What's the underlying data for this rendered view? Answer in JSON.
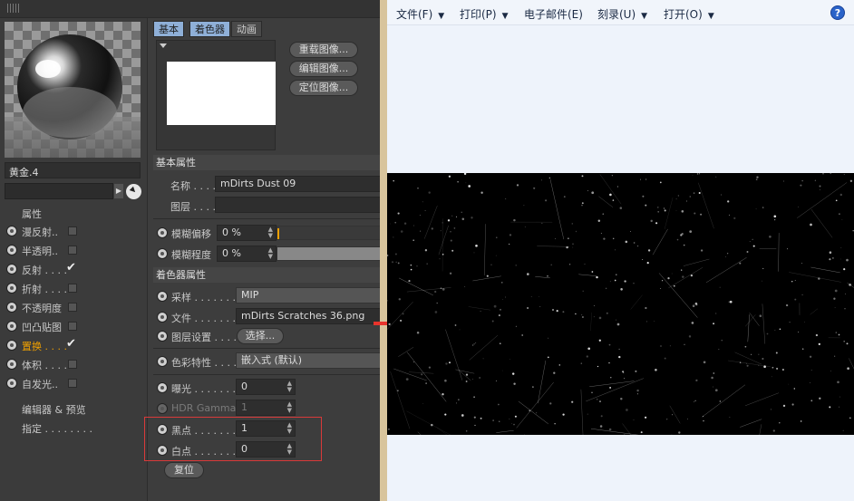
{
  "material": {
    "name": "黄金.4",
    "section_title": "属性",
    "channels": [
      {
        "label": "漫反射..",
        "checked": false
      },
      {
        "label": "半透明..",
        "checked": false
      },
      {
        "label": "反射 . . . .",
        "checked": true
      },
      {
        "label": "折射 . . . .",
        "checked": false
      },
      {
        "label": "不透明度",
        "checked": false
      },
      {
        "label": "凹凸贴图",
        "checked": false
      },
      {
        "label": "置换 . . . .",
        "checked": true,
        "active": true
      },
      {
        "label": "体积 . . . .",
        "checked": false
      },
      {
        "label": "自发光..",
        "checked": false
      }
    ],
    "editor_preview": "编辑器 & 预览",
    "assign": "指定 . . . . . . . ."
  },
  "tabs": [
    "基本",
    "着色器",
    "动画"
  ],
  "image_buttons": [
    "重载图像...",
    "编辑图像...",
    "定位图像..."
  ],
  "basic_props": {
    "header": "基本属性",
    "name_label": "名称 . . . .",
    "name_value": "mDirts Dust 09",
    "layer_label": "图层 . . . .",
    "layer_value": ""
  },
  "blur": {
    "offset_label": "模糊偏移",
    "offset_value": "0 %",
    "strength_label": "模糊程度",
    "strength_value": "0 %"
  },
  "shader_props": {
    "header": "着色器属性",
    "sampling_label": "采样 . . . . . . . .",
    "sampling_value": "MIP",
    "file_label": "文件 . . . . . . . .",
    "file_value": "mDirts Scratches 36.png",
    "layer_setup_label": "图层设置 . . . .",
    "layer_setup_button": "选择...",
    "color_profile_label": "色彩特性 . . . . .",
    "color_profile_value": "嵌入式 (默认)",
    "exposure_label": "曝光 . . . . . . . .",
    "exposure_value": "0",
    "hdr_label": "HDR Gamma",
    "hdr_value": "1",
    "black_label": "黑点 . . . . . . . .",
    "black_value": "1",
    "white_label": "白点 . . . . . . . .",
    "white_value": "0",
    "reset_button": "复位"
  },
  "viewer": {
    "menus": [
      {
        "label": "文件(F)",
        "caret": true
      },
      {
        "label": "打印(P)",
        "caret": true
      },
      {
        "label": "电子邮件(E)",
        "caret": false
      },
      {
        "label": "刻录(U)",
        "caret": true
      },
      {
        "label": "打开(O)",
        "caret": true
      }
    ],
    "help": "?"
  },
  "colors": {
    "accent_active": "#f0a000",
    "highlight_box": "#d93a3a",
    "arrow": "#e8342c",
    "tab_selected": "#8fb0d8"
  }
}
